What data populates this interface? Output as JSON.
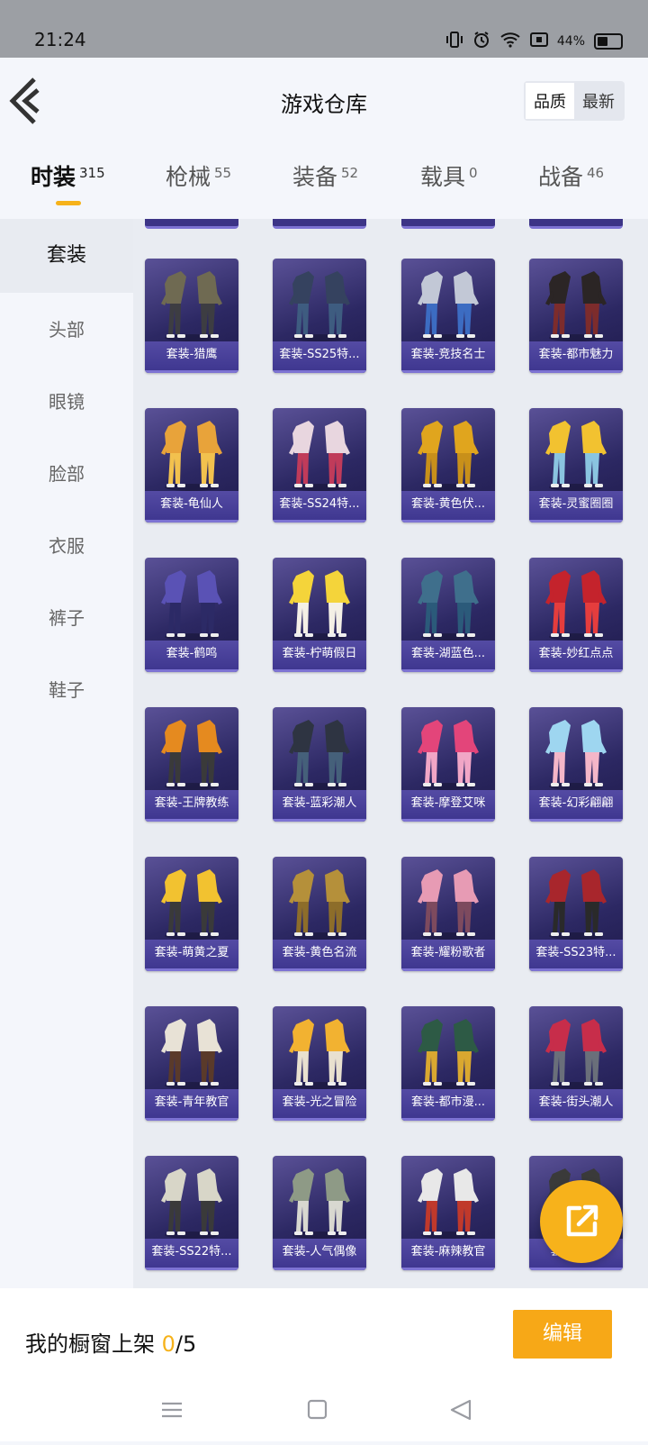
{
  "status": {
    "time": "21:24",
    "battery": "44%",
    "battery_level": 0.44
  },
  "header": {
    "title": "游戏仓库",
    "sort_options": [
      "品质",
      "最新"
    ],
    "sort_active": "品质"
  },
  "tabs": [
    {
      "label": "时装",
      "count": "315"
    },
    {
      "label": "枪械",
      "count": "55"
    },
    {
      "label": "装备",
      "count": "52"
    },
    {
      "label": "载具",
      "count": "0"
    },
    {
      "label": "战备",
      "count": "46"
    }
  ],
  "sidebar": [
    "套装",
    "头部",
    "眼镜",
    "脸部",
    "衣服",
    "裤子",
    "鞋子"
  ],
  "items": [
    {
      "label": "套装-猎鹰",
      "colors": [
        "#6f6a52",
        "#3d3d42"
      ]
    },
    {
      "label": "套装-SS25特...",
      "colors": [
        "#35425f",
        "#3e5c80"
      ]
    },
    {
      "label": "套装-竞技名士",
      "colors": [
        "#c2c8d6",
        "#3c6cc2"
      ]
    },
    {
      "label": "套装-都市魅力",
      "colors": [
        "#2b2525",
        "#7d2c2c"
      ]
    },
    {
      "label": "套装-龟仙人",
      "colors": [
        "#e8a33a",
        "#f2c14e"
      ]
    },
    {
      "label": "套装-SS24特...",
      "colors": [
        "#e8d6df",
        "#c03b5a"
      ]
    },
    {
      "label": "套装-黄色伏...",
      "colors": [
        "#e0a51e",
        "#c8901a"
      ]
    },
    {
      "label": "套装-灵蜜圈圈",
      "colors": [
        "#f2c230",
        "#8ac4e0"
      ]
    },
    {
      "label": "套装-鹤鸣",
      "colors": [
        "#5a52b5",
        "#2c2a66"
      ]
    },
    {
      "label": "套装-柠萌假日",
      "colors": [
        "#f4d43a",
        "#f4f0e6"
      ]
    },
    {
      "label": "套装-湖蓝色...",
      "colors": [
        "#3f6f8c",
        "#2b5a7a"
      ]
    },
    {
      "label": "套装-妙红点点",
      "colors": [
        "#c4232c",
        "#e53d3d"
      ]
    },
    {
      "label": "套装-王牌教练",
      "colors": [
        "#e58a1f",
        "#3a3a3a"
      ]
    },
    {
      "label": "套装-蓝彩潮人",
      "colors": [
        "#2e3442",
        "#45607a"
      ]
    },
    {
      "label": "套装-摩登艾咪",
      "colors": [
        "#e3457a",
        "#f1a6c6"
      ]
    },
    {
      "label": "套装-幻彩翩翩",
      "colors": [
        "#9ed6f0",
        "#f4b6c8"
      ]
    },
    {
      "label": "套装-萌黄之夏",
      "colors": [
        "#f2c230",
        "#3a3a3a"
      ]
    },
    {
      "label": "套装-黄色名流",
      "colors": [
        "#b5903a",
        "#8d6d2a"
      ]
    },
    {
      "label": "套装-耀粉歌者",
      "colors": [
        "#e79bb4",
        "#7d4a5e"
      ]
    },
    {
      "label": "套装-SS23特...",
      "colors": [
        "#a8262c",
        "#2a2a2a"
      ]
    },
    {
      "label": "套装-青年教官",
      "colors": [
        "#e8e2d6",
        "#5a3a2a"
      ]
    },
    {
      "label": "套装-光之冒险",
      "colors": [
        "#f2b231",
        "#e8e0cf"
      ]
    },
    {
      "label": "套装-都市漫...",
      "colors": [
        "#2d5a45",
        "#d9a830"
      ]
    },
    {
      "label": "套装-街头潮人",
      "colors": [
        "#c72d4a",
        "#6a6f7a"
      ]
    },
    {
      "label": "套装-SS22特...",
      "colors": [
        "#d8d6c8",
        "#3a3a3a"
      ]
    },
    {
      "label": "套装-人气偶像",
      "colors": [
        "#8e9a86",
        "#d8d8d0"
      ]
    },
    {
      "label": "套装-麻辣教官",
      "colors": [
        "#e8e8e8",
        "#c0392b"
      ]
    },
    {
      "label": "套装-猛禽",
      "colors": [
        "#3a3a3a",
        "#6d6d6d"
      ]
    }
  ],
  "bottom": {
    "showcase_prefix": "我的橱窗上架 ",
    "showcase_count": "0",
    "showcase_total": "/5",
    "edit_label": "编辑"
  },
  "colors": {
    "accent": "#f6b21a",
    "button": "#f7a817",
    "card_bg": "#2c2863",
    "card_label": "#4a42a0"
  }
}
